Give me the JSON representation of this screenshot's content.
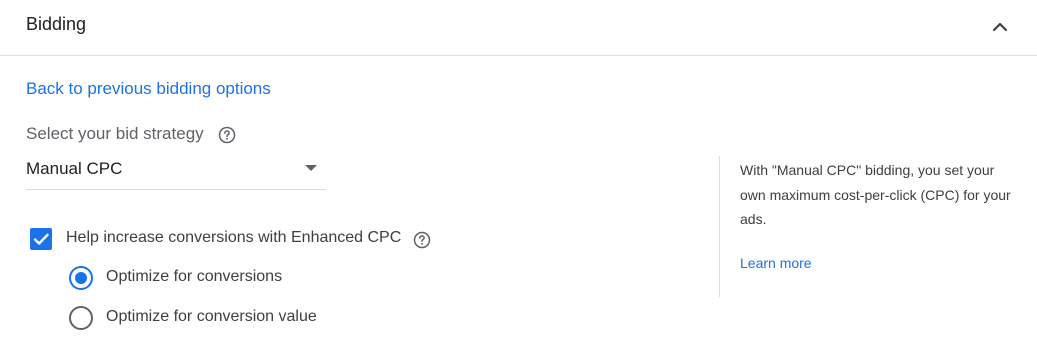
{
  "section": {
    "title": "Bidding",
    "collapse_icon": "chevron-up-icon"
  },
  "back_link": "Back to previous bidding options",
  "strategy": {
    "label": "Select your bid strategy",
    "help_icon": "help-circle-icon",
    "selected": "Manual CPC"
  },
  "enhanced_cpc": {
    "checked": true,
    "label": "Help increase conversions with Enhanced CPC",
    "help_icon": "help-circle-icon",
    "options": [
      {
        "label": "Optimize for conversions",
        "selected": true
      },
      {
        "label": "Optimize for conversion value",
        "selected": false
      }
    ]
  },
  "info": {
    "text": "With \"Manual CPC\" bidding, you set your own maximum cost-per-click (CPC) for your ads.",
    "learn_more": "Learn more"
  },
  "colors": {
    "accent": "#1a73e8",
    "text": "#202124",
    "secondary_text": "#5f6368",
    "divider": "#dadce0"
  }
}
